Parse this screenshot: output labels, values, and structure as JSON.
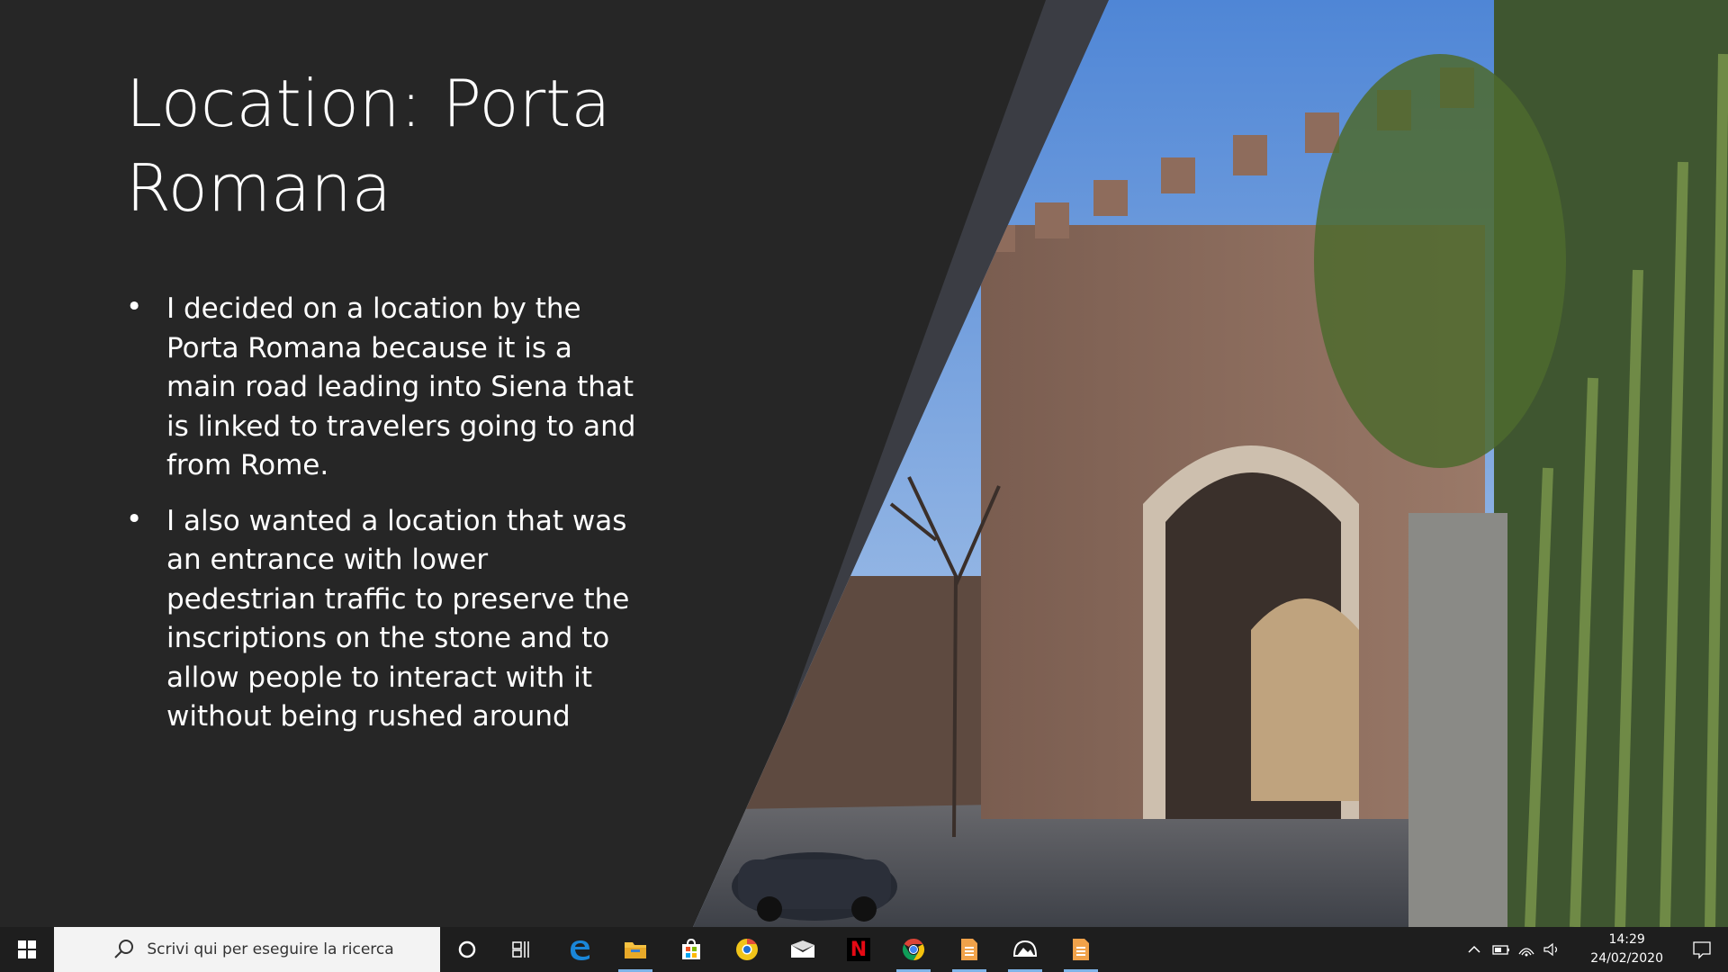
{
  "slide": {
    "title_line1": "Location: Porta",
    "title_line2": "Romana",
    "bullets": [
      {
        "lines": [
          "I decided on a location by the",
          "Porta Romana because it is a",
          "main road leading into Siena that",
          "is linked to travelers going to and",
          "from Rome."
        ]
      },
      {
        "lines": [
          "I also wanted a location that was",
          "an entrance with lower",
          "pedestrian traffic to preserve the",
          "inscriptions on the stone and to",
          "allow people to interact with it",
          "without being rushed around"
        ]
      }
    ],
    "bullet_glyph": "•"
  },
  "taskbar": {
    "search_placeholder": "Scrivi qui per eseguire la ricerca",
    "apps": [
      {
        "icon": "cortana-icon"
      },
      {
        "icon": "task-view-icon"
      },
      {
        "icon": "edge-icon"
      },
      {
        "icon": "file-explorer-icon",
        "active": true
      },
      {
        "icon": "store-icon"
      },
      {
        "icon": "chrome-canary-icon"
      },
      {
        "icon": "mail-icon"
      },
      {
        "icon": "netflix-icon",
        "label": "N"
      },
      {
        "icon": "chrome-icon",
        "active": true
      },
      {
        "icon": "document-icon",
        "active": true
      },
      {
        "icon": "photos-icon",
        "active": true
      },
      {
        "icon": "powerpoint-icon",
        "active": true
      }
    ],
    "tray": {
      "time": "14:29",
      "date": "24/02/2020"
    }
  },
  "colors": {
    "slide_bg": "#262626",
    "taskbar_bg": "#1e1e1e",
    "accent_underline": "#7fb4e8",
    "sky": "#7ea8dc",
    "brick": "#8c6b5a",
    "foliage": "#6f8a46"
  }
}
